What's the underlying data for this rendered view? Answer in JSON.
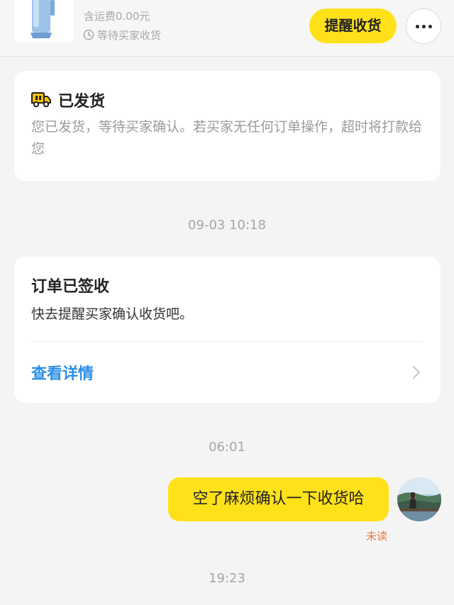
{
  "order": {
    "product_image": "product-thumbnail",
    "shipping_fee": "含运费0.00元",
    "status": "等待买家收货",
    "status_icon": "clock-icon",
    "remind_button": "提醒收货",
    "more_icon": "more-icon"
  },
  "shipped_card": {
    "icon": "truck-icon",
    "title": "已发货",
    "description": "您已发货，等待买家确认。若买家无任何订单操作，超时将打款给您"
  },
  "timestamps": {
    "first": "09-03 10:18",
    "second": "06:01",
    "third": "19:23"
  },
  "signed_card": {
    "title": "订单已签收",
    "description": "快去提醒买家确认收货吧。",
    "link_label": "查看详情",
    "chevron_icon": "chevron-right-icon"
  },
  "message": {
    "text": "空了麻烦确认一下收货哈",
    "read_status": "未读",
    "avatar": "user-avatar"
  },
  "colors": {
    "accent_yellow": "#ffe11a",
    "link_blue": "#2a8ee6",
    "unread_orange": "#e87a3b",
    "background": "#f4f4f4"
  }
}
